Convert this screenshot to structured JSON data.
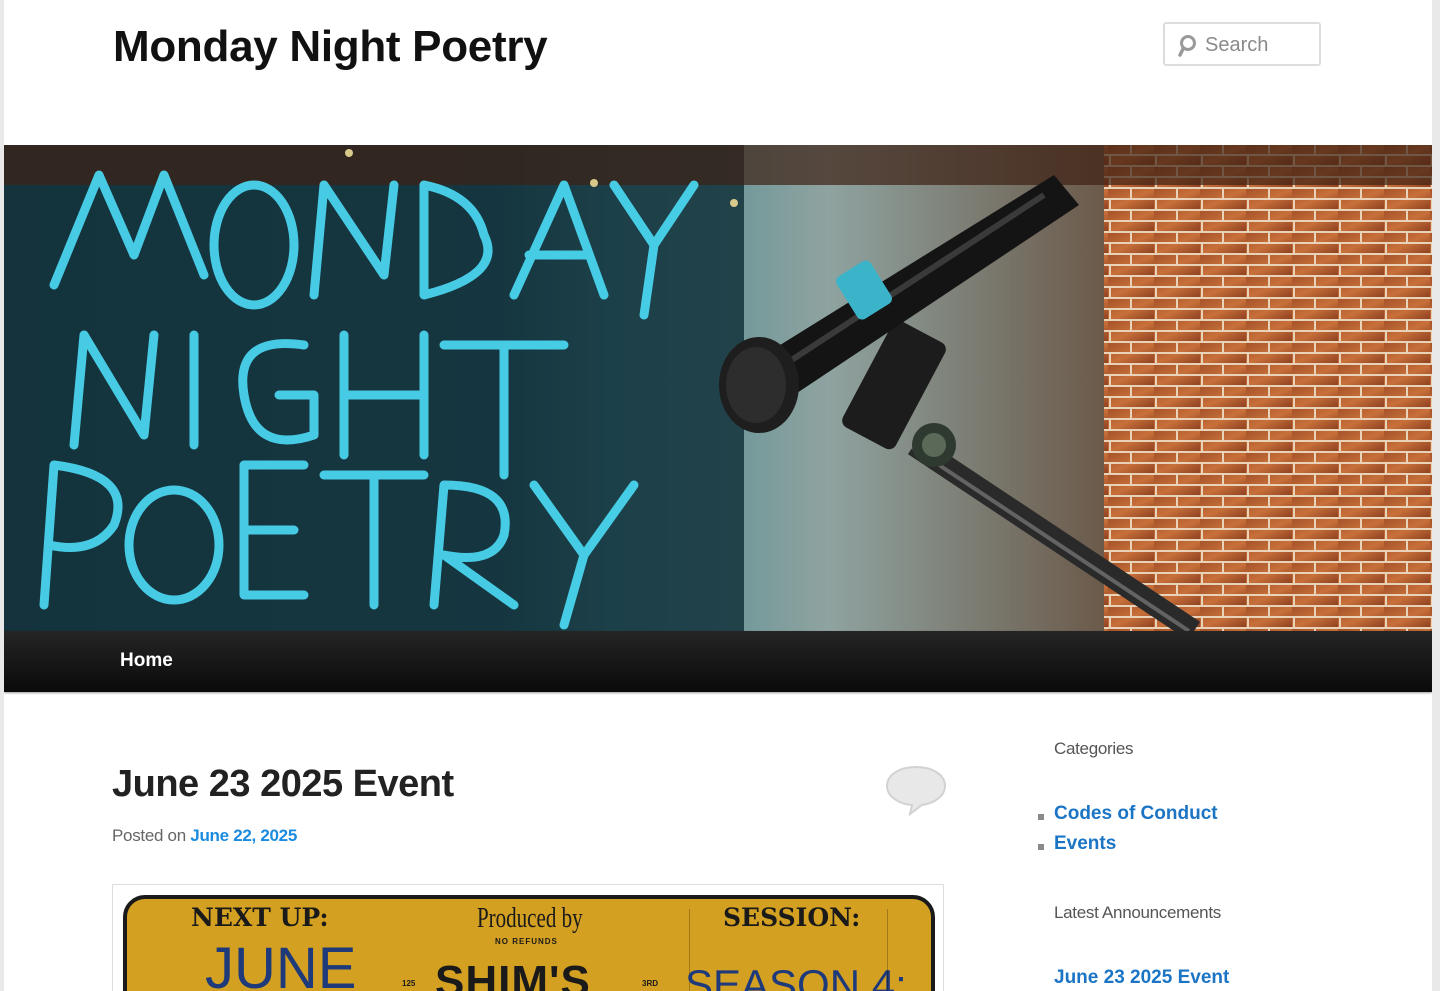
{
  "site": {
    "title": "Monday Night Poetry"
  },
  "search": {
    "placeholder": "Search"
  },
  "banner": {
    "lettering": "MONDAY NIGHT POETRY"
  },
  "nav": {
    "items": [
      {
        "label": "Home"
      }
    ]
  },
  "post": {
    "title": "June 23 2025 Event",
    "posted_on_label": "Posted on",
    "date": "June 22, 2025",
    "poster": {
      "next_up": "NEXT UP:",
      "month": "JUNE",
      "produced_by": "Produced by",
      "no_refunds": "NO REFUNDS",
      "venue": "SHIM'S",
      "small_left": "125",
      "small_right": "3RD",
      "session": "SESSION:",
      "season": "SEASON 4:"
    }
  },
  "sidebar": {
    "categories_title": "Categories",
    "categories": [
      {
        "label": "Codes of Conduct"
      },
      {
        "label": "Events"
      }
    ],
    "announcements_title": "Latest Announcements",
    "announcements": [
      {
        "label": "June 23 2025 Event"
      }
    ]
  },
  "colors": {
    "link": "#1b75c4",
    "nav_bg": "#151515",
    "poster_bg": "#d4a021"
  }
}
